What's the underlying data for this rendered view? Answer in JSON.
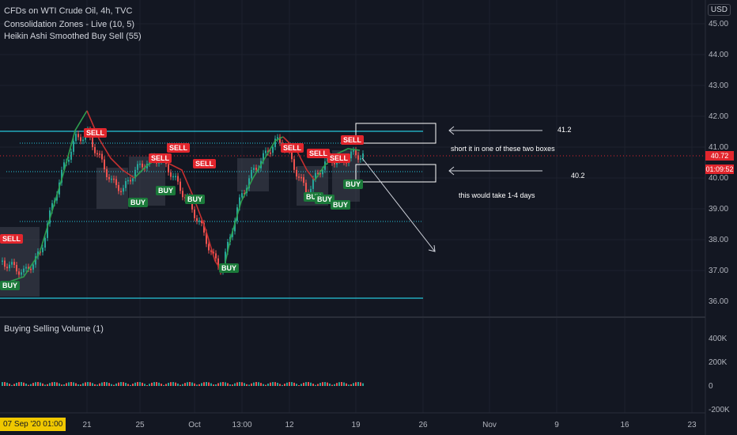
{
  "header": {
    "symbol_title": "CFDs on WTI Crude Oil, 4h, TVC",
    "indicator_1": "Consolidation Zones - Live (10, 5)",
    "indicator_2": "Heikin Ashi Smoothed Buy Sell  (55)",
    "currency": "USD"
  },
  "price_axis": {
    "labels": [
      "45.00",
      "44.00",
      "43.00",
      "42.00",
      "41.00",
      "40.00",
      "39.00",
      "38.00",
      "37.00",
      "36.00"
    ],
    "last_price": "40.72",
    "countdown": "01:09:52",
    "price_color": "#e2262d"
  },
  "volume_panel": {
    "title": "Buying Selling Volume (1)",
    "labels": [
      "400K",
      "200K",
      "0",
      "-200K"
    ]
  },
  "time_axis": {
    "labels": [
      "21",
      "25",
      "Oct",
      "13:00",
      "12",
      "19",
      "26",
      "Nov",
      "9",
      "16",
      "23"
    ],
    "cursor_label": "07 Sep '20  01:00"
  },
  "signals": {
    "sell": [
      "SELL",
      "SELL",
      "SELL",
      "SELL",
      "SELL",
      "SELL",
      "SELL",
      "SELL",
      "SELL"
    ],
    "buy": [
      "BUY",
      "BUY",
      "BUY",
      "BUY",
      "BUY",
      "BUY",
      "BUY",
      "BUY",
      "BUY"
    ]
  },
  "annotations": {
    "upper_level": "41.2",
    "lower_level": "40.2",
    "note_1": "short it in one of these two boxes",
    "note_2": "this would take 1-4 days"
  },
  "colors": {
    "background": "#131722",
    "support_resistance": "#26c6da",
    "sell": "#e2262d",
    "buy": "#1b7a3a",
    "zone": "#4a4e5a"
  }
}
